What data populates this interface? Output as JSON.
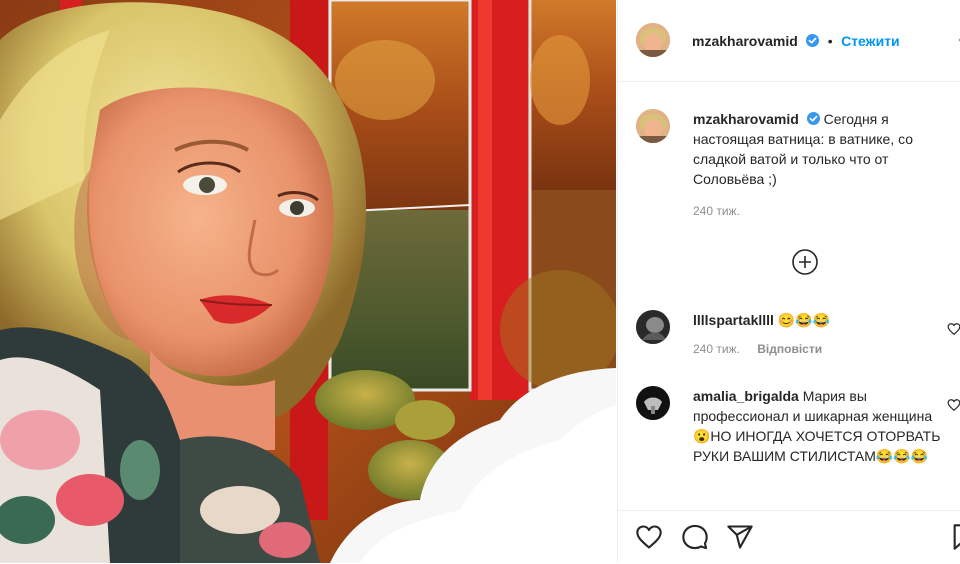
{
  "photo": {
    "alt": ""
  },
  "header": {
    "username": "mzakharovamid",
    "verified": true,
    "separator": "•",
    "follow_label": "Стежити"
  },
  "caption": {
    "username": "mzakharovamid",
    "text": "Сегодня я настоящая ватница: в ватнике, со сладкой ватой и только что от Соловьёва ;)",
    "time": "240 тиж."
  },
  "load_more_icon": "plus-circle-icon",
  "comments": [
    {
      "username": "llllspartakllll",
      "text": "😊😂😂",
      "time": "240 тиж.",
      "reply_label": "Відповісти"
    },
    {
      "username": "amalia_brigalda",
      "text": "Мария вы профессионал и шикарная женщина😮НО ИНОГДА ХОЧЕТСЯ ОТОРВАТЬ РУКИ ВАШИМ СТИЛИСТАМ😂😂😂"
    }
  ],
  "actions": {
    "like_icon": "heart-icon",
    "comment_icon": "comment-icon",
    "share_icon": "share-icon",
    "save_icon": "bookmark-icon"
  },
  "colors": {
    "accent": "#0095f6",
    "verified": "#3897f0",
    "muted": "#8e8e8e",
    "text": "#262626"
  }
}
